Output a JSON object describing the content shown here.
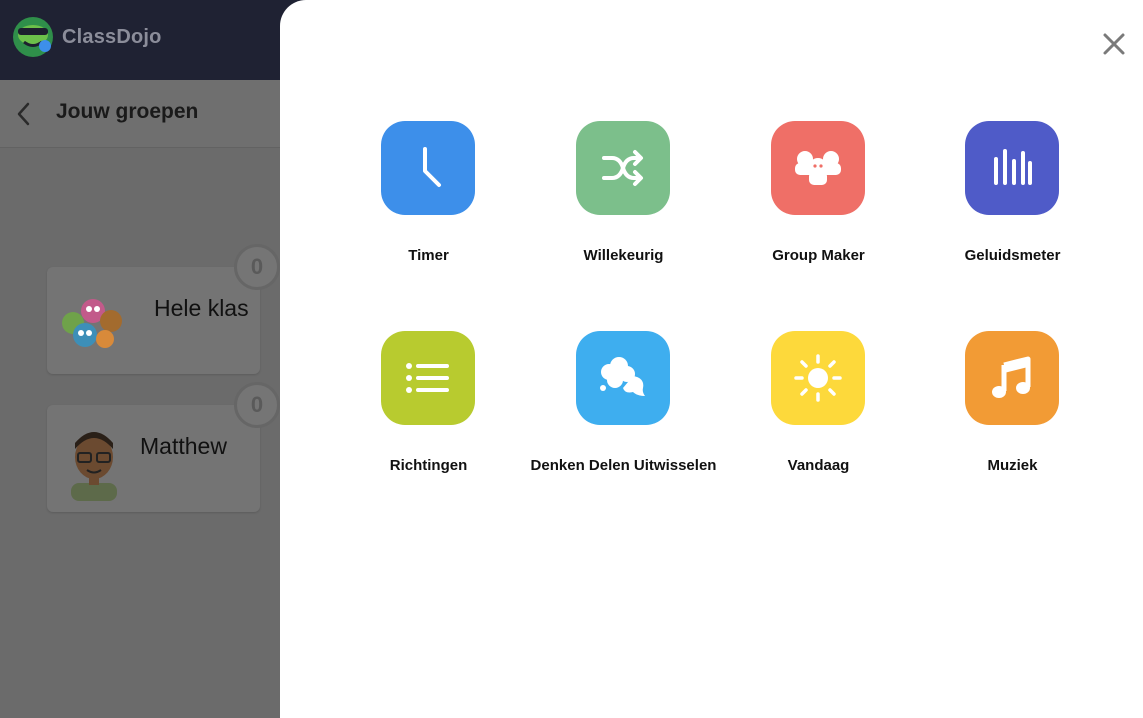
{
  "app": {
    "brand": "ClassDojo"
  },
  "header": {
    "title": "Jouw groepen"
  },
  "groups": [
    {
      "name": "Hele klas",
      "points": "0"
    },
    {
      "name": "Matthew",
      "points": "0"
    }
  ],
  "toolkit": {
    "tools": [
      {
        "label": "Timer",
        "color": "#3d8fea",
        "icon": "clock-icon"
      },
      {
        "label": "Willekeurig",
        "color": "#7cbf8b",
        "icon": "shuffle-icon"
      },
      {
        "label": "Group Maker",
        "color": "#ef6f67",
        "icon": "group-icon"
      },
      {
        "label": "Geluidsmeter",
        "color": "#4f5bc8",
        "icon": "sound-meter-icon"
      },
      {
        "label": "Richtingen",
        "color": "#b8cb2f",
        "icon": "list-icon"
      },
      {
        "label": "Denken Delen Uitwisselen",
        "color": "#3eaeef",
        "icon": "chat-bubbles-icon"
      },
      {
        "label": "Vandaag",
        "color": "#fdd93b",
        "icon": "sun-icon"
      },
      {
        "label": "Muziek",
        "color": "#f29b35",
        "icon": "music-note-icon"
      }
    ]
  }
}
